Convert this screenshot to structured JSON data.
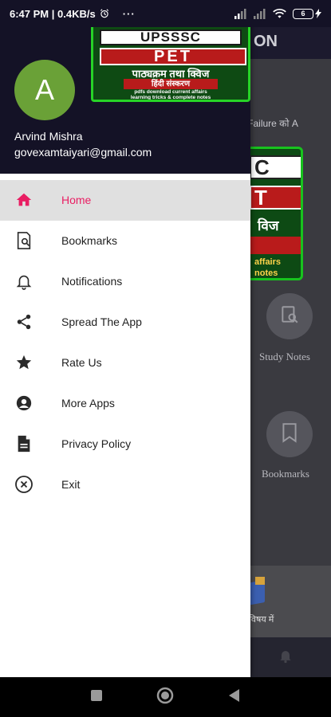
{
  "status_bar": {
    "time_speed": "6:47 PM | 0.4KB/s",
    "more": "···",
    "battery": "6"
  },
  "background_app": {
    "title_fragment": "ON",
    "ticker": "प Failure को A",
    "tiles": [
      {
        "label": "Study Notes",
        "icon": "notes-search-icon"
      },
      {
        "label": "Bookmarks",
        "icon": "bookmark-icon"
      }
    ],
    "banner_partial": [
      "C",
      "T",
      "विज",
      "affairs",
      "notes"
    ],
    "bottom_card_text": "विषय में"
  },
  "drawer": {
    "logo": {
      "line1": "UPSSSC",
      "line2": "PET",
      "line3": "पाठ्यक्रम तथा क्विज",
      "line4": "हिंदी संस्करण",
      "line5": "pdfs download     current affairs",
      "line6": "learning tricks & complete notes"
    },
    "avatar_letter": "A",
    "user_name": "Arvind Mishra",
    "user_email": "govexamtaiyari@gmail.com",
    "accent_color": "#e91e63",
    "items": [
      {
        "label": "Home",
        "icon": "home-icon",
        "active": true
      },
      {
        "label": "Bookmarks",
        "icon": "bookmark-search-icon",
        "active": false
      },
      {
        "label": "Notifications",
        "icon": "bell-icon",
        "active": false
      },
      {
        "label": "Spread The App",
        "icon": "share-icon",
        "active": false
      },
      {
        "label": "Rate Us",
        "icon": "star-icon",
        "active": false
      },
      {
        "label": "More Apps",
        "icon": "account-circle-icon",
        "active": false
      },
      {
        "label": "Privacy Policy",
        "icon": "document-icon",
        "active": false
      },
      {
        "label": "Exit",
        "icon": "close-circle-icon",
        "active": false
      }
    ]
  }
}
